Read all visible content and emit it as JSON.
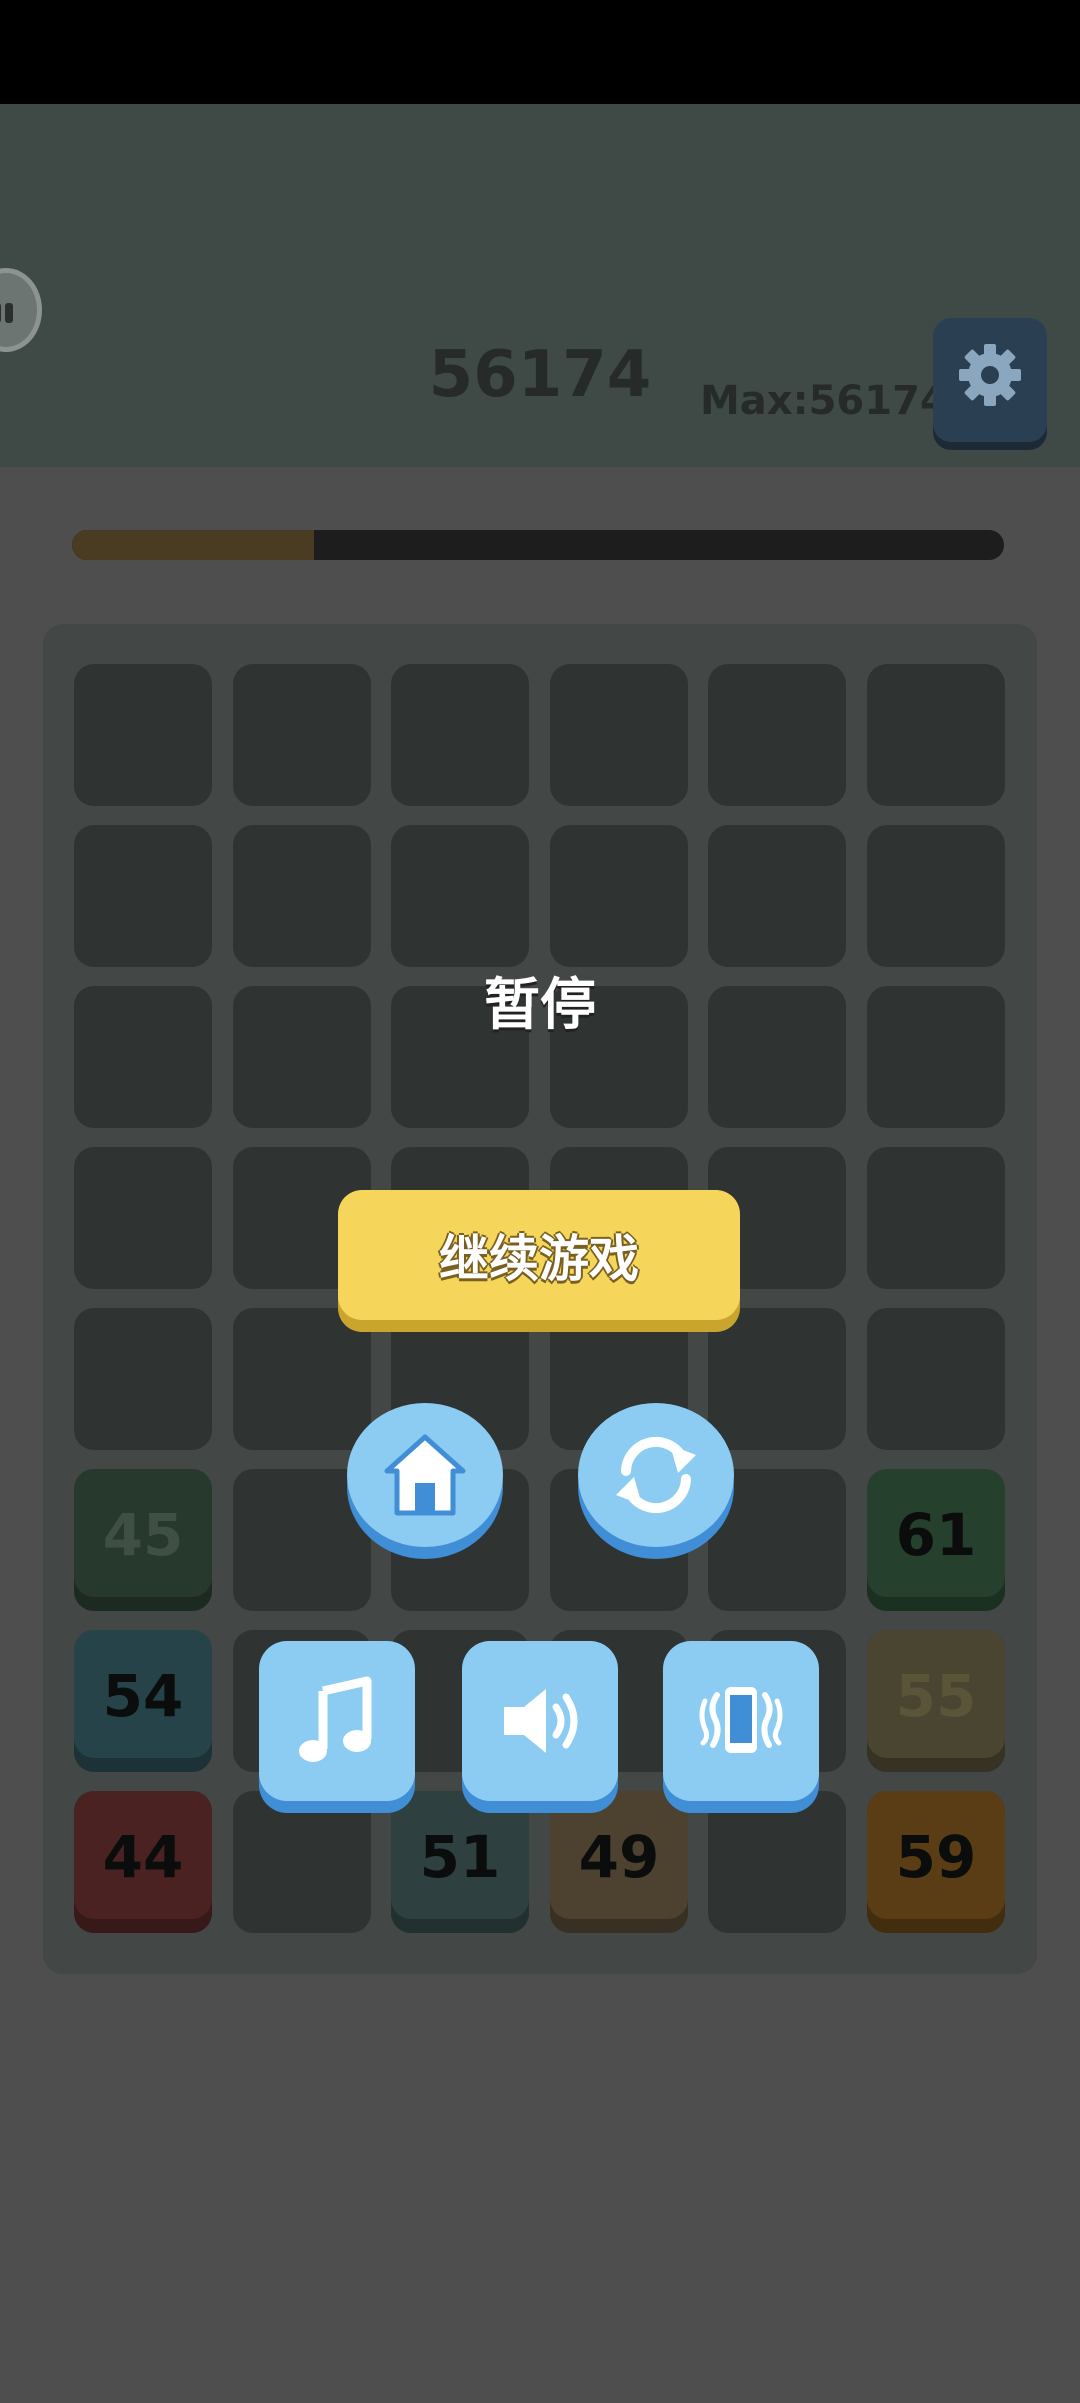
{
  "header": {
    "score": "56174",
    "max_score": "Max:56174",
    "progress_fraction": 0.26
  },
  "pause_menu": {
    "title": "暂停",
    "resume_label": "继续游戏",
    "buttons": [
      "home-icon",
      "restart-icon",
      "music-icon",
      "sound-icon",
      "vibration-icon"
    ]
  },
  "board": {
    "columns": 6,
    "rows": 8,
    "tiles": [
      {
        "row": 6,
        "col": 1,
        "value": "45",
        "color": "#27392d",
        "text_color": "#3f4f43"
      },
      {
        "row": 6,
        "col": 6,
        "value": "61",
        "color": "#26402e",
        "text_color": "#0b0d0c"
      },
      {
        "row": 7,
        "col": 1,
        "value": "54",
        "color": "#27434a",
        "text_color": "#0b0d0c"
      },
      {
        "row": 7,
        "col": 6,
        "value": "55",
        "color": "#4a4530",
        "text_color": "#5a5438"
      },
      {
        "row": 8,
        "col": 1,
        "value": "44",
        "color": "#4a2222",
        "text_color": "#0b0d0c"
      },
      {
        "row": 8,
        "col": 3,
        "value": "51",
        "color": "#2e4140",
        "text_color": "#0b0d0c"
      },
      {
        "row": 8,
        "col": 4,
        "value": "49",
        "color": "#4d4130",
        "text_color": "#0b0d0c"
      },
      {
        "row": 8,
        "col": 6,
        "value": "59",
        "color": "#5a3d14",
        "text_color": "#0b0d0c"
      }
    ]
  }
}
